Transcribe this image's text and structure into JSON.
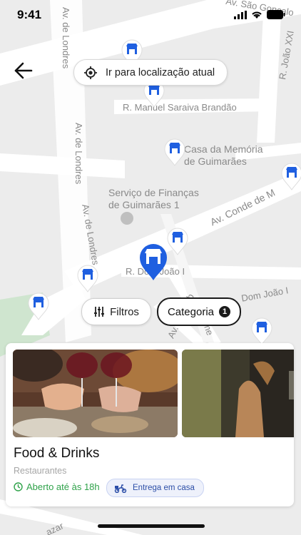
{
  "status_bar": {
    "time": "9:41"
  },
  "map": {
    "streets": [
      {
        "id": "av-sao-goncalo",
        "label": "Av. São Gonçalo"
      },
      {
        "id": "av-londres-top",
        "label": "Av. de Londres"
      },
      {
        "id": "r-joao-xxi",
        "label": "R. João XXI"
      },
      {
        "id": "r-manuel-saraiva",
        "label": "R. Manuel Saraiva Brandão"
      },
      {
        "id": "av-londres-mid",
        "label": "Av. de Londres"
      },
      {
        "id": "av-londres-low",
        "label": "Av. de Londres"
      },
      {
        "id": "av-conde",
        "label": "Av. Conde de M"
      },
      {
        "id": "r-dom-joao",
        "label": "R. Dom João I"
      },
      {
        "id": "r-dom-joao-2",
        "label": "Dom João I"
      },
      {
        "id": "av-prof",
        "label": "Av. Prof. Ab"
      },
      {
        "id": "r-sexta",
        "label": "me"
      },
      {
        "id": "bottom-street",
        "label": "azar"
      }
    ],
    "places": [
      {
        "id": "casa-memoria",
        "label": "Casa da Memória\nde Guimarães"
      },
      {
        "id": "servico-financas",
        "label": "Serviço de Finanças\nde Guimarães 1"
      }
    ]
  },
  "header": {
    "back_icon": "arrow-left-icon",
    "locate_button_label": "Ir para localização atual"
  },
  "filters": {
    "filters_label": "Filtros",
    "category_label": "Categoria",
    "category_count": "1"
  },
  "card": {
    "title": "Food & Drinks",
    "subtitle": "Restaurantes",
    "hours": "Aberto até às 18h",
    "delivery_label": "Entrega em casa"
  },
  "colors": {
    "accent": "#1f5fe0",
    "open_green": "#2fa24a",
    "map_bg": "#ececec",
    "road": "#ffffff"
  }
}
